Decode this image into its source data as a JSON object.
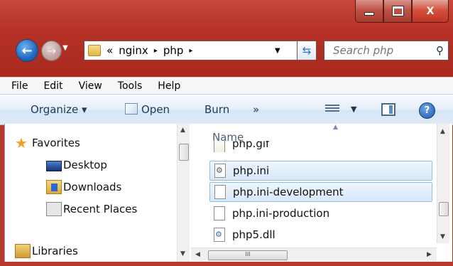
{
  "window": {
    "buttons": {
      "minimize": "minimize",
      "maximize": "maximize",
      "close": "X"
    }
  },
  "navigation": {
    "back_glyph": "←",
    "forward_glyph": "→",
    "address": {
      "overflow": "«",
      "segments": [
        "nginx",
        "php"
      ],
      "separator": "▸"
    },
    "search_placeholder": "Search php"
  },
  "menu": [
    "File",
    "Edit",
    "View",
    "Tools",
    "Help"
  ],
  "toolbar": {
    "organize": "Organize ▾",
    "open": "Open",
    "burn": "Burn",
    "more": "»",
    "help_glyph": "?"
  },
  "nav_pane": {
    "items": [
      {
        "label": "Favorites",
        "icon": "star-icon"
      },
      {
        "label": "Desktop",
        "icon": "desktop-icon"
      },
      {
        "label": "Downloads",
        "icon": "downloads-folder-icon"
      },
      {
        "label": "Recent Places",
        "icon": "recent-places-icon"
      },
      {
        "label": "Libraries",
        "icon": "libraries-icon"
      }
    ]
  },
  "file_list": {
    "column_header": "Name",
    "files": [
      {
        "name": "php.gif",
        "icon": "gif-file-icon",
        "selected": false
      },
      {
        "name": "php.ini",
        "icon": "config-file-icon",
        "selected": true
      },
      {
        "name": "php.ini-development",
        "icon": "file-icon",
        "selected": true
      },
      {
        "name": "php.ini-production",
        "icon": "file-icon",
        "selected": false
      },
      {
        "name": "php5.dll",
        "icon": "dll-file-icon",
        "selected": false
      }
    ],
    "hscroll_grip": "III"
  }
}
